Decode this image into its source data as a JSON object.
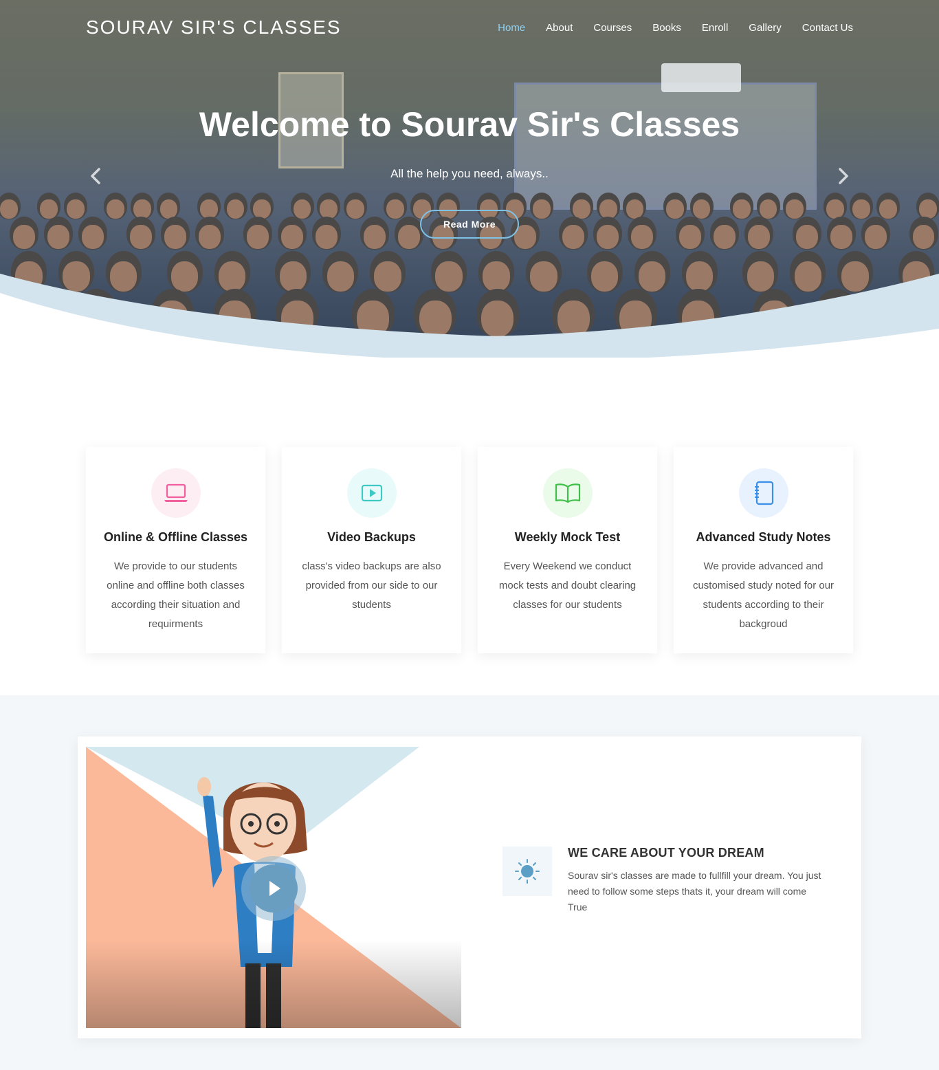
{
  "brand": "SOURAV SIR'S CLASSES",
  "nav": {
    "items": [
      {
        "label": "Home",
        "active": true
      },
      {
        "label": "About"
      },
      {
        "label": "Courses"
      },
      {
        "label": "Books"
      },
      {
        "label": "Enroll"
      },
      {
        "label": "Gallery"
      },
      {
        "label": "Contact Us"
      }
    ]
  },
  "hero": {
    "title": "Welcome to Sourav Sir's Classes",
    "subtitle": "All the help you need, always..",
    "button": "Read More",
    "prev_icon": "chevron-left-icon",
    "next_icon": "chevron-right-icon"
  },
  "features": [
    {
      "title": "Online & Offline Classes",
      "text": "We provide to our students online and offline both classes according their situation and requirments",
      "icon": "laptop-icon",
      "color": "#f0609e",
      "bg": "#fdeef3"
    },
    {
      "title": "Video Backups",
      "text": "class's video backups are also provided from our side to our students",
      "icon": "video-play-icon",
      "color": "#3fc9c5",
      "bg": "#e8fbfa"
    },
    {
      "title": "Weekly Mock Test",
      "text": "Every Weekend we conduct mock tests and doubt clearing classes for our students",
      "icon": "open-book-icon",
      "color": "#3fbf4a",
      "bg": "#ebfbea"
    },
    {
      "title": "Advanced Study Notes",
      "text": "We provide advanced and customised study noted for our students according to their backgroud",
      "icon": "notebook-icon",
      "color": "#3c8fe6",
      "bg": "#e8f2fe"
    }
  ],
  "about": {
    "title": "WE CARE ABOUT YOUR DREAM",
    "text": "Sourav sir's classes are made to fullfill your dream. You just need to follow some steps thats it, your dream will come True",
    "icon": "sun-icon",
    "play_icon": "play-icon"
  },
  "colors": {
    "accent": "#8fd3f4",
    "wave": "#d3e4ee",
    "section_bg": "#f3f7fa"
  }
}
